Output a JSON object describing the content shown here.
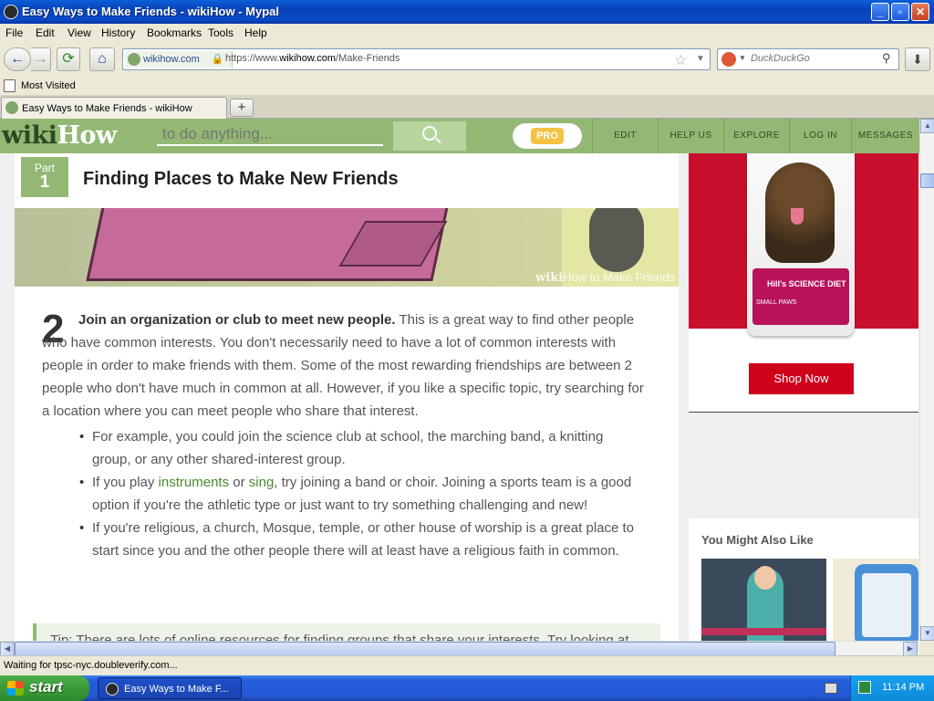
{
  "window": {
    "title": "Easy Ways to Make Friends - wikiHow - Mypal"
  },
  "menu": [
    "File",
    "Edit",
    "View",
    "History",
    "Bookmarks",
    "Tools",
    "Help"
  ],
  "navbar": {
    "site_identity": "wikihow.com",
    "url_prefix": "https://www.",
    "url_domain": "wikihow.com",
    "url_path": "/Make-Friends",
    "search_placeholder": "DuckDuckGo"
  },
  "bookmarks": {
    "most_visited": "Most Visited"
  },
  "tabs": [
    {
      "label": "Easy Ways to Make Friends - wikiHow"
    }
  ],
  "wikihow": {
    "logo_a": "wiki",
    "logo_b": "How",
    "search_placeholder": "to do anything...",
    "pro": "PRO",
    "nav": [
      "EDIT",
      "HELP US",
      "EXPLORE",
      "LOG IN",
      "MESSAGES"
    ]
  },
  "article": {
    "part_label": "Part",
    "part_number": "1",
    "part_title": "Finding Places to Make New Friends",
    "watermark_a": "wiki",
    "watermark_b": "How to Make Friends",
    "step_number": "2",
    "step_bold": "Join an organization or club to meet new people.",
    "step_text": " This is a great way to find other people who have common interests. You don't necessarily need to have a lot of common interests with people in order to make friends with them. Some of the most rewarding friendships are between 2 people who don't have much in common at all. However, if you like a specific topic, try searching for a location where you can meet people who share that interest.",
    "bullets": {
      "b1": "For example, you could join the science club at school, the marching band, a knitting group, or any other shared-interest group.",
      "b2_pre": "If you play ",
      "b2_link1": "instruments",
      "b2_mid": " or ",
      "b2_link2": "sing",
      "b2_post": ", try joining a band or choir. Joining a sports team is a good option if you're the athletic type or just want to try something challenging and new!",
      "b3": "If you're religious, a church, Mosque, temple, or other house of worship is a great place to start since you and the other people there will at least have a religious faith in common."
    },
    "tip_partial": "Tip: There are lots of online resources for finding groups that share your interests. Try looking at"
  },
  "ad": {
    "brand": "Hill's SCIENCE DIET",
    "product": "SMALL PAWS",
    "cta": "Shop Now"
  },
  "sidebar": {
    "you_might_also_like": "You Might Also Like"
  },
  "status": {
    "text": "Waiting for tpsc-nyc.doubleverify.com..."
  },
  "taskbar": {
    "start": "start",
    "task": "Easy Ways to Make F...",
    "clock": "11:14 PM"
  },
  "colors": {
    "wikihow_green": "#93b874",
    "title_bar": "#0a4bc8",
    "ad_red": "#c8102e"
  }
}
